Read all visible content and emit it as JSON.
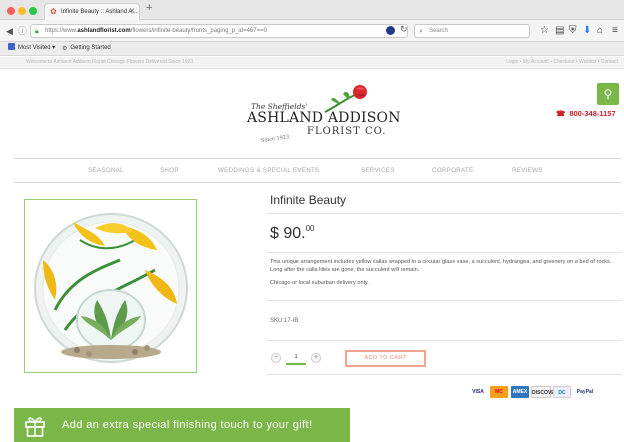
{
  "browser": {
    "tab_title": "Infinite Beauty :: Ashland A...",
    "url_prefix": "https://www.",
    "url_domain": "ashlandflorist.com",
    "url_path": "/flowers/infinite-beauty/fronts_paging_p_id=467==0",
    "search_placeholder": "Search",
    "bookmarks": [
      "Most Visited",
      "Getting Started"
    ]
  },
  "site": {
    "topstrip_left": "Welcome to Ashland Addison Florist Chicago Flowers Delivered Since 1923",
    "topstrip_right": "Login  •  My Account  •  Checkout  •  Wishlist  •  Contact",
    "logo_pre": "The Sheffields'",
    "logo_main": "ASHLAND ADDISON",
    "logo_sub": "FLORIST CO.",
    "logo_since": "Since 1923",
    "phone": "800-348-1157",
    "menu": [
      "SEASONAL",
      "SHOP",
      "WEDDINGS & SPECIAL EVENTS",
      "SERVICES",
      "CORPORATE",
      "REVIEWS"
    ]
  },
  "product": {
    "title": "Infinite Beauty",
    "price_main": "$ 90.",
    "price_cents": "00",
    "description": "This unique arrangement includes yellow callas wrapped in a circular glass vase, a succulent, hydrangea, and greenery on a bed of rocks. Long after the calla lilies are gone, the succulent will remain.",
    "delivery_note": "Chicago or local suburban delivery only.",
    "sku": "SKU:17-IB",
    "quantity": "1",
    "add_to_cart": "ADD TO CART"
  },
  "payments": [
    "VISA",
    "MC",
    "AMEX",
    "DISCOVER",
    "DC",
    "PayPal"
  ],
  "promo": {
    "text": "Add an extra special finishing touch to your gift!"
  },
  "colors": {
    "brand_green": "#7ab648",
    "brand_red": "#c81f27",
    "cart_salmon": "#f09077"
  }
}
